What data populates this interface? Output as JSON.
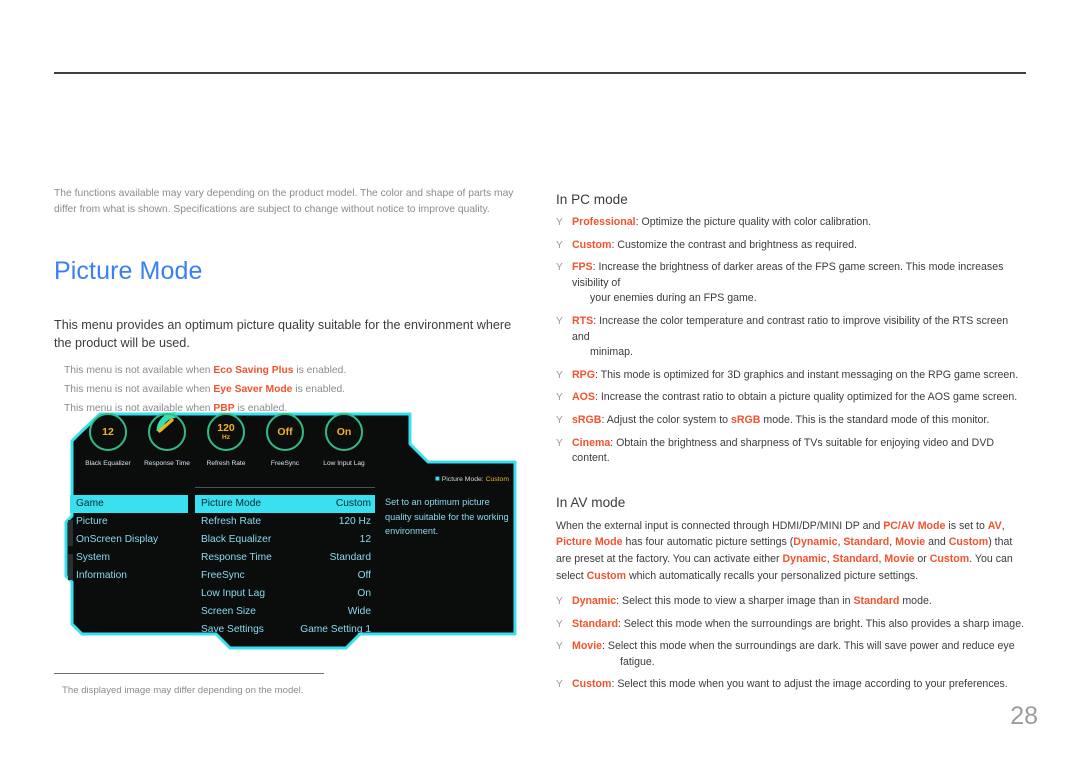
{
  "document": {
    "page_number": "28"
  },
  "left": {
    "disclaimer": "The functions available may vary depending on the product model. The color and shape of parts may differ from what is shown. Specifications are subject to change without notice to improve quality.",
    "section_title": "Picture Mode",
    "intro": "This menu provides an optimum picture quality suitable for the environment where the product will be used.",
    "notes": [
      {
        "before": "This menu is not available when ",
        "term": "Eco Saving Plus",
        "after": " is enabled."
      },
      {
        "before": "This menu is not available when ",
        "term": "Eye Saver Mode",
        "after": " is enabled."
      },
      {
        "before": "This menu is not available when ",
        "term": "PBP",
        "after": " is enabled."
      }
    ],
    "figure_caption": "The displayed image may differ depending on the model."
  },
  "osd": {
    "dials": [
      {
        "value": "12",
        "unit": "",
        "caption": "Black Equalizer"
      },
      {
        "value": "",
        "unit": "",
        "caption": "Response Time",
        "gauge": true
      },
      {
        "value": "120",
        "unit": "Hz",
        "caption": "Refresh Rate"
      },
      {
        "value": "Off",
        "unit": "",
        "caption": "FreeSync"
      },
      {
        "value": "On",
        "unit": "",
        "caption": "Low Input Lag"
      }
    ],
    "categories": [
      {
        "label": "Game",
        "selected": true
      },
      {
        "label": "Picture",
        "selected": false
      },
      {
        "label": "OnScreen Display",
        "selected": false
      },
      {
        "label": "System",
        "selected": false
      },
      {
        "label": "Information",
        "selected": false
      }
    ],
    "settings": [
      {
        "label": "Picture Mode",
        "value": "Custom",
        "selected": true
      },
      {
        "label": "Refresh Rate",
        "value": "120 Hz",
        "selected": false
      },
      {
        "label": "Black Equalizer",
        "value": "12",
        "selected": false
      },
      {
        "label": "Response Time",
        "value": "Standard",
        "selected": false
      },
      {
        "label": "FreeSync",
        "value": "Off",
        "selected": false
      },
      {
        "label": "Low Input Lag",
        "value": "On",
        "selected": false
      },
      {
        "label": "Screen Size",
        "value": "Wide",
        "selected": false
      },
      {
        "label": "Save Settings",
        "value": "Game Setting 1",
        "selected": false
      }
    ],
    "help": {
      "header_label": "Picture Mode:",
      "header_value": "Custom",
      "body": "Set to an optimum picture quality suitable for the working environment."
    },
    "colors": {
      "border": "#3ae0f0",
      "panel": "#0b0d0d",
      "accent_text": "#89d9ee",
      "value_yellow": "#f0b323",
      "ring_green": "#2fbd84"
    }
  },
  "right": {
    "pc_mode": {
      "heading": "In PC mode",
      "bullet_mark": "Y",
      "items": [
        {
          "term": "Professional",
          "rest": ": Optimize the picture quality with color calibration."
        },
        {
          "term": "Custom",
          "rest": ": Customize the contrast and brightness as required."
        },
        {
          "term": "FPS",
          "rest": ": Increase the brightness of darker areas of the FPS game screen. This mode increases visibility of",
          "cont": "your enemies during an FPS game."
        },
        {
          "term": "RTS",
          "rest": ": Increase the color temperature and contrast ratio to improve visibility of the RTS screen and",
          "cont": "minimap."
        },
        {
          "term": "RPG",
          "rest": ": This mode is optimized for 3D graphics and instant messaging on the RPG game screen."
        },
        {
          "term": "AOS",
          "rest": ": Increase the contrast ratio to obtain a picture quality optimized for the AOS game screen."
        },
        {
          "term": "sRGB",
          "rest_a": ": Adjust the color system to ",
          "term_b": "sRGB",
          "rest_b": " mode. This is the standard mode of this monitor."
        },
        {
          "term": "Cinema",
          "rest": ": Obtain the brightness and sharpness of TVs suitable for enjoying video and DVD content."
        }
      ]
    },
    "av_mode": {
      "heading": "In AV mode",
      "bullet_mark": "Y",
      "paragraph": {
        "p1": "When the external input is connected through HDMI/DP/MINI DP and ",
        "t1": "PC/AV Mode",
        "p2": " is set to ",
        "t2": "AV",
        "p3": ", ",
        "t3": "Picture Mode",
        "p4": " has four automatic picture settings (",
        "t4": "Dynamic",
        "p5": ", ",
        "t5": "Standard",
        "p6": ", ",
        "t6": "Movie",
        "p7": " and ",
        "t7": "Custom",
        "p8": ") that are preset at the factory. You can activate either ",
        "t8": "Dynamic",
        "p9": ", ",
        "t9": "Standard",
        "p10": ", ",
        "t10": "Movie",
        "p11": " or ",
        "t11": "Custom",
        "p12": ". You can select ",
        "t12": "Custom",
        "p13": " which automatically recalls your personalized picture settings."
      },
      "items": [
        {
          "term": "Dynamic",
          "rest_a": ": Select this mode to view a sharper image than in ",
          "term_b": "Standard",
          "rest_b": " mode."
        },
        {
          "term": "Standard",
          "rest": ": Select this mode when the surroundings are bright. This also provides a sharp image."
        },
        {
          "term": "Movie",
          "rest": ": Select this mode when the surroundings are dark. This will save power and reduce eye",
          "cont": "fatigue."
        },
        {
          "term": "Custom",
          "rest": ": Select this mode when you want to adjust the image according to your preferences."
        }
      ]
    }
  }
}
